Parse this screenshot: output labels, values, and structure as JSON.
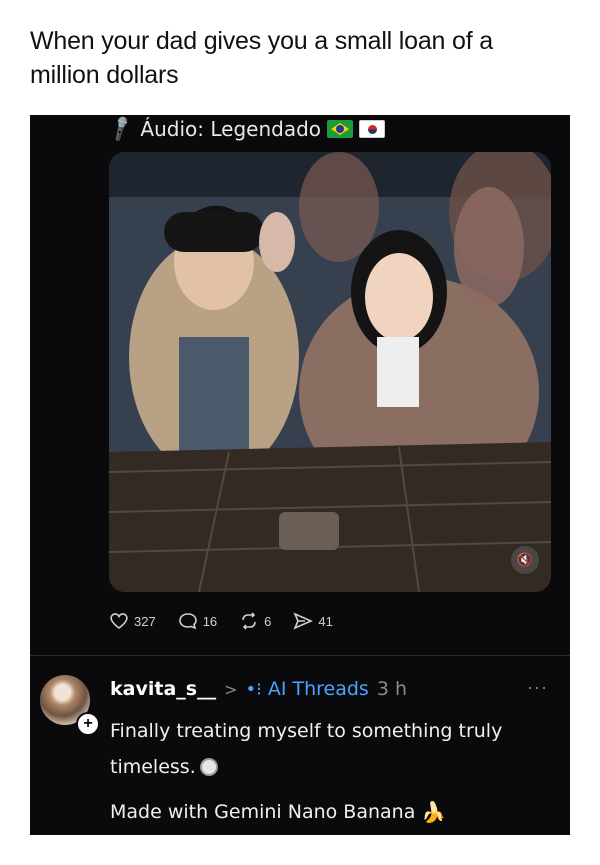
{
  "caption": "When your dad gives you a small loan of a million dollars",
  "post": {
    "audio_label": "Áudio: Legendado",
    "flags": [
      "brazil-flag",
      "south-korea-flag"
    ],
    "mute_icon": "muted-speaker-icon",
    "actions": {
      "likes": "327",
      "replies": "16",
      "reposts": "6",
      "shares": "41"
    }
  },
  "reply": {
    "username": "kavita_s__",
    "separator": ">",
    "community": "AI Threads",
    "time": "3 h",
    "more": "···",
    "text": "Finally treating myself to something truly timeless.",
    "footer": "Made with Gemini Nano Banana"
  },
  "colors": {
    "background": "#0a0a0c",
    "accent_blue": "#4aa3ff",
    "muted_text": "#8a8a8a"
  }
}
